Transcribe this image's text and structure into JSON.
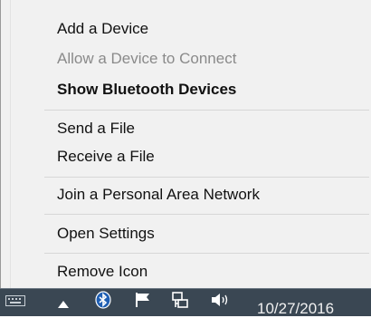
{
  "menu": {
    "items": [
      {
        "label": "Add a Device"
      },
      {
        "label": "Allow a Device to Connect"
      },
      {
        "label": "Show Bluetooth Devices"
      },
      {
        "label": "Send a File"
      },
      {
        "label": "Receive a File"
      },
      {
        "label": "Join a Personal Area Network"
      },
      {
        "label": "Open Settings"
      },
      {
        "label": "Remove Icon"
      }
    ]
  },
  "taskbar": {
    "clock": "10/27/2016",
    "icons": [
      "keyboard-icon",
      "show-hidden-icons-arrow",
      "bluetooth-icon",
      "flag-icon",
      "network-icon",
      "volume-icon"
    ]
  },
  "colors": {
    "menu_bg": "#f1f1f1",
    "separator": "#d7d7d7",
    "disabled_text": "#8a8a8a",
    "taskbar_bg": "#3a4753"
  }
}
